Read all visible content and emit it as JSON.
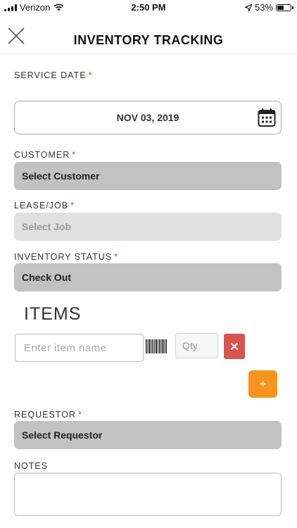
{
  "status_bar": {
    "carrier": "Verizon",
    "time": "2:50 PM",
    "battery": "53%",
    "battery_level": 0.53
  },
  "header": {
    "title": "INVENTORY TRACKING"
  },
  "form": {
    "service_date": {
      "label": "SERVICE DATE",
      "value": "NOV 03, 2019"
    },
    "customer": {
      "label": "CUSTOMER",
      "value": "Select Customer"
    },
    "lease_job": {
      "label": "LEASE/JOB",
      "value": "Select Job"
    },
    "inventory_status": {
      "label": "INVENTORY STATUS",
      "value": "Check Out"
    },
    "requestor": {
      "label": "REQUESTOR",
      "value": "Select Requestor"
    },
    "notes": {
      "label": "NOTES",
      "value": ""
    },
    "required_marker": "*"
  },
  "items": {
    "heading": "ITEMS",
    "item_placeholder": "Enter item name",
    "qty_placeholder": "Qty",
    "add_label": "+"
  },
  "colors": {
    "required": "#d9342b",
    "remove_button": "#d9534f",
    "add_button": "#f7941d",
    "select_bg": "#c2c2c2",
    "select_disabled_bg": "#e0e0e0"
  }
}
